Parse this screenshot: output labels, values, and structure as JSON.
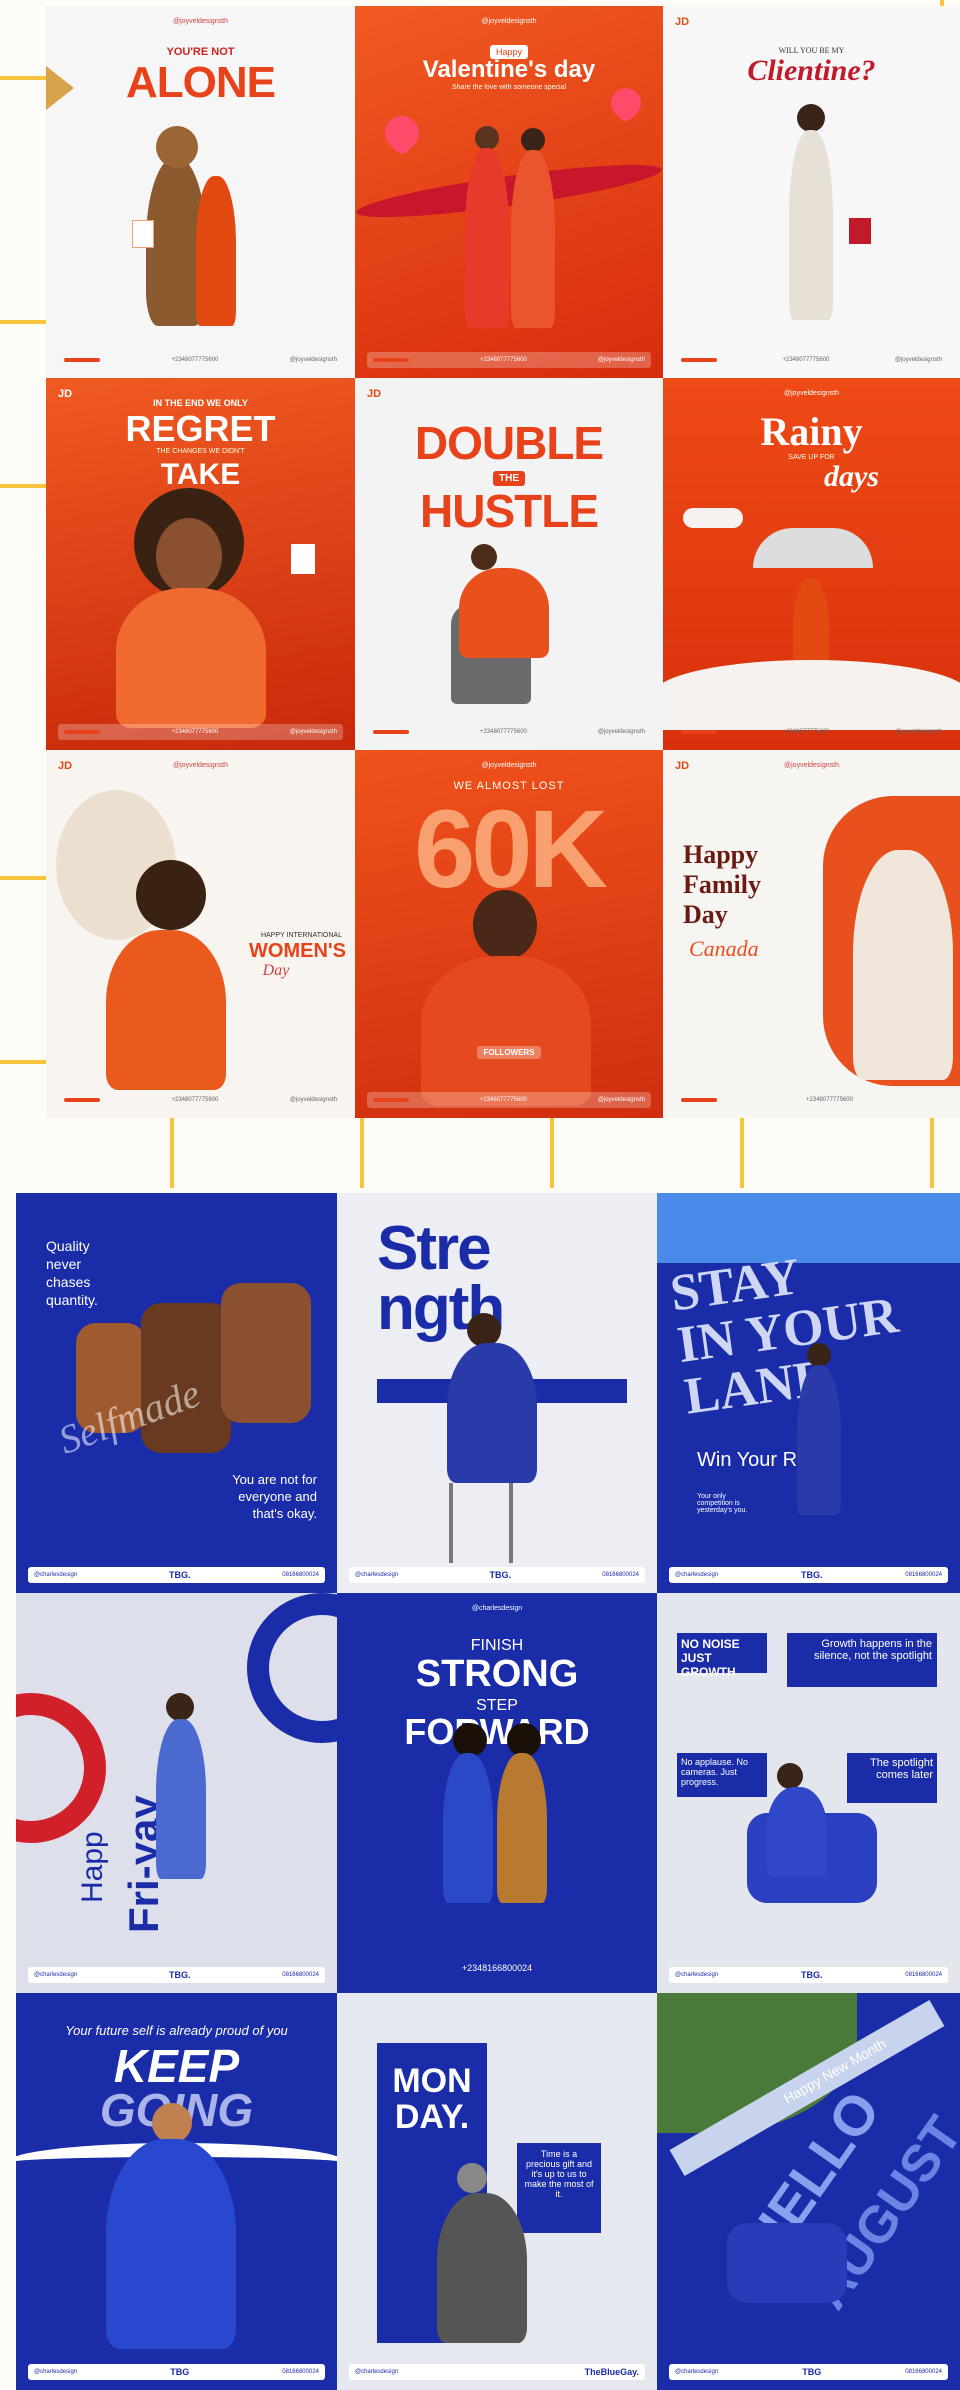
{
  "colors": {
    "orange": "#e8421a",
    "deep_orange": "#d8330e",
    "blue": "#1a2ca8",
    "navy": "#101e86",
    "light": "#eef0f6",
    "cream": "#fefcf6",
    "yellow": "#f7c53a"
  },
  "top_grid": [
    {
      "id": "alone",
      "handle": "@joyveldesignsth",
      "pre": "YOU'RE NOT",
      "title": "ALONE",
      "phone": "+2348077775600",
      "social": "@joyveldesignsth"
    },
    {
      "id": "valentine",
      "handle": "@joyveldesignsth",
      "pre": "Happy",
      "title": "Valentine's day",
      "sub": "Share the love with someone special",
      "phone": "+2348077775600",
      "social": "@joyveldesignsth"
    },
    {
      "id": "clientine",
      "logo": "JD",
      "pre": "WILL YOU BE MY",
      "title": "Clientine?",
      "phone": "+2348077775600",
      "social": "@joyveldesignsth"
    },
    {
      "id": "regret",
      "logo": "JD",
      "pre": "IN THE END WE ONLY",
      "title": "REGRET",
      "mid": "THE CHANGES WE DIDN'T",
      "title2": "TAKE",
      "phone": "+2348077775600",
      "social": "@joyveldesignsth"
    },
    {
      "id": "hustle",
      "logo": "JD",
      "title": "DOUBLE",
      "badge": "THE",
      "title2": "HUSTLE",
      "phone": "+2348077775600",
      "social": "@joyveldesignsth"
    },
    {
      "id": "rainy",
      "handle": "@joyveldesignsth",
      "title": "Rainy",
      "sub": "SAVE UP FOR",
      "title2": "days",
      "phone": "+2348077775600",
      "social": "@joyveldesignsth"
    },
    {
      "id": "women",
      "logo": "JD",
      "handle": "@joyveldesignsth",
      "pre": "HAPPY INTERNATIONAL",
      "title": "WOMEN'S",
      "title2": "Day",
      "phone": "+2348077775600",
      "social": "@joyveldesignsth"
    },
    {
      "id": "sixty",
      "handle": "@joyveldesignsth",
      "pre": "WE ALMOST LOST",
      "title": "60K",
      "cta": "FOLLOWERS",
      "phone": "+2348077775600",
      "social": "@joyveldesignsth"
    },
    {
      "id": "family",
      "logo": "JD",
      "handle": "@joyveldesignsth",
      "title": "Happy",
      "title2": "Family",
      "title3": "Day",
      "script": "Canada",
      "phone": "+2348077775600"
    }
  ],
  "bottom_grid": [
    {
      "id": "quality",
      "text": "Quality never chases quantity.",
      "sub": "You are not for everyone and that's okay.",
      "watermark": "Selfmade",
      "brand": "TBG.",
      "handle": "@charlesdesign",
      "phone": "08166800024"
    },
    {
      "id": "strength",
      "title": "Stre",
      "title2": "ngth",
      "brand": "TBG.",
      "handle": "@charlesdesign",
      "phone": "08166800024"
    },
    {
      "id": "stay",
      "t1": "STAY",
      "t2": "IN YOUR",
      "t3": "LANE",
      "sub": "Win Your Race.",
      "note": "Your only competition is yesterday's you.",
      "brand": "TBG.",
      "handle": "@charlesdesign",
      "phone": "08166800024"
    },
    {
      "id": "friyay",
      "t1": "Happ",
      "t2": "Fri-yay",
      "brand": "TBG.",
      "handle": "@charlesdesign",
      "phone": "08166800024"
    },
    {
      "id": "finish",
      "top": "@charlesdesign",
      "t1": "FINISH",
      "t2": "STRONG",
      "t3": "STEP",
      "t4": "FORWARD",
      "phone": "+2348166800024"
    },
    {
      "id": "noise",
      "t1": "NO NOISE",
      "t2": "JUST GROWTH",
      "r1": "Growth happens in the silence, not the spotlight",
      "l1": "No applause. No cameras. Just progress.",
      "r2": "The spotlight comes later",
      "brand": "TBG.",
      "handle": "@charlesdesign",
      "phone": "08166800024"
    },
    {
      "id": "keep",
      "pre": "Your future self is already proud of you",
      "t1": "KEEP",
      "t2": "GOING",
      "brand": "TBG",
      "handle": "@charlesdesign",
      "phone": "08166800024"
    },
    {
      "id": "monday",
      "t1": "MON",
      "t2": "DAY.",
      "text": "Time is a precious gift and it's up to us to make the most of it.",
      "handle": "@charlesdesign",
      "brand": "TheBlueGay."
    },
    {
      "id": "august",
      "t1": "Happy New Month",
      "t2": "HELLO",
      "t3": "AUGUST",
      "handle": "@charlesdesign",
      "brand": "TBG",
      "phone": "08166800024"
    }
  ]
}
